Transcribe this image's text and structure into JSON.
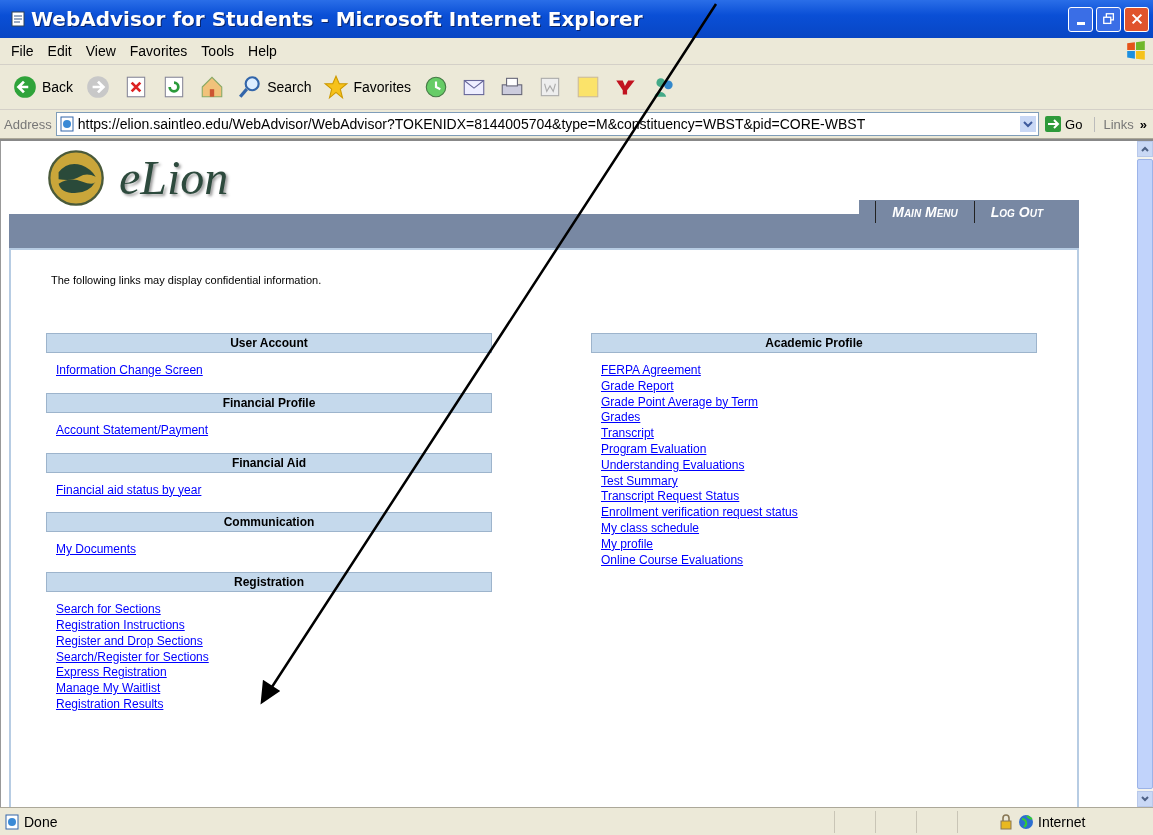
{
  "window": {
    "title": "WebAdvisor for Students - Microsoft Internet Explorer"
  },
  "menu_bar": [
    "File",
    "Edit",
    "View",
    "Favorites",
    "Tools",
    "Help"
  ],
  "toolbar": [
    {
      "kind": "back",
      "label": "Back"
    },
    {
      "kind": "forward"
    },
    {
      "kind": "stop"
    },
    {
      "kind": "refresh"
    },
    {
      "kind": "home"
    },
    {
      "kind": "search",
      "label": "Search"
    },
    {
      "kind": "favorites",
      "label": "Favorites"
    },
    {
      "kind": "history"
    },
    {
      "kind": "mail"
    },
    {
      "kind": "print"
    },
    {
      "kind": "edit"
    },
    {
      "kind": "note"
    },
    {
      "kind": "yahoo"
    },
    {
      "kind": "messenger"
    }
  ],
  "address_bar": {
    "label": "Address",
    "url": "https://elion.saintleo.edu/WebAdvisor/WebAdvisor?TOKENIDX=8144005704&type=M&constituency=WBST&pid=CORE-WBST",
    "go": "Go",
    "links": "Links",
    "links_more": "»"
  },
  "page": {
    "logo": "eLion",
    "nav": [
      "Main Menu",
      "Log Out"
    ],
    "notice": "The following links may display confidential information.",
    "left_sections": [
      {
        "title": "User Account",
        "links": [
          "Information Change Screen"
        ]
      },
      {
        "title": "Financial Profile",
        "links": [
          "Account Statement/Payment"
        ]
      },
      {
        "title": "Financial Aid",
        "links": [
          "Financial aid status by year"
        ]
      },
      {
        "title": "Communication",
        "links": [
          "My Documents"
        ]
      },
      {
        "title": "Registration",
        "links": [
          "Search for Sections",
          "Registration Instructions",
          "Register and Drop Sections",
          "Search/Register for Sections",
          "Express Registration",
          "Manage My Waitlist",
          "Registration Results"
        ]
      }
    ],
    "right_sections": [
      {
        "title": "Academic Profile",
        "links": [
          "FERPA Agreement",
          "Grade Report",
          "Grade Point Average by Term",
          "Grades",
          "Transcript",
          "Program Evaluation",
          "Understanding Evaluations",
          "Test Summary",
          "Transcript Request Status",
          "Enrollment verification request status",
          "My class schedule",
          "My profile",
          "Online Course Evaluations"
        ]
      }
    ]
  },
  "status_bar": {
    "status": "Done",
    "zone": "Internet"
  }
}
